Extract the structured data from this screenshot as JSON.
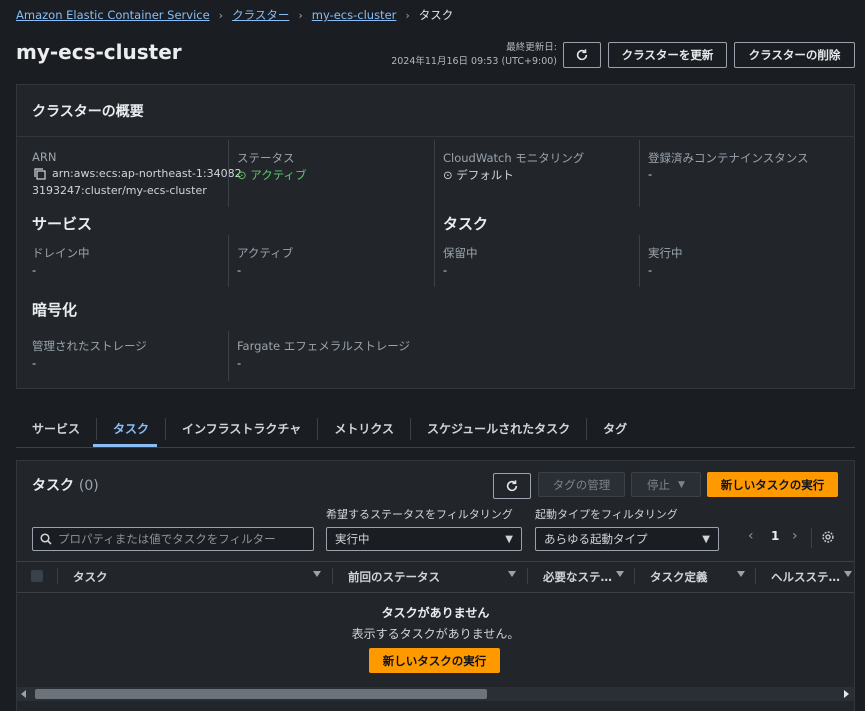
{
  "breadcrumb": {
    "items": [
      "Amazon Elastic Container Service",
      "クラスター",
      "my-ecs-cluster"
    ],
    "current": "タスク"
  },
  "header": {
    "title": "my-ecs-cluster",
    "updated_label": "最終更新日:",
    "updated_value": "2024年11月16日 09:53 (UTC+9:00)",
    "refresh_icon": "refresh-icon",
    "update_button": "クラスターを更新",
    "delete_button": "クラスターの削除"
  },
  "overview": {
    "title": "クラスターの概要",
    "arn_label": "ARN",
    "arn_line1": "arn:aws:ecs:ap-northeast-1:34082",
    "arn_line2": "3193247:cluster/my-ecs-cluster",
    "status_label": "ステータス",
    "status_value": "アクティブ",
    "cloudwatch_label": "CloudWatch モニタリング",
    "cloudwatch_value": "デフォルト",
    "instances_label": "登録済みコンテナインスタンス",
    "instances_value": "-",
    "services_title": "サービス",
    "draining_label": "ドレイン中",
    "draining_value": "-",
    "active_label": "アクティブ",
    "active_value": "-",
    "tasks_title": "タスク",
    "pending_label": "保留中",
    "pending_value": "-",
    "running_label": "実行中",
    "running_value": "-",
    "encryption_title": "暗号化",
    "managed_storage_label": "管理されたストレージ",
    "managed_storage_value": "-",
    "fargate_storage_label": "Fargate エフェメラルストレージ",
    "fargate_storage_value": "-"
  },
  "tabs": [
    "サービス",
    "タスク",
    "インフラストラクチャ",
    "メトリクス",
    "スケジュールされたタスク",
    "タグ"
  ],
  "tasks": {
    "title": "タスク",
    "count": "(0)",
    "manage_tags_button": "タグの管理",
    "stop_button": "停止",
    "run_button": "新しいタスクの実行",
    "search_placeholder": "プロパティまたは値でタスクをフィルター",
    "status_filter_label": "希望するステータスをフィルタリング",
    "status_filter_value": "実行中",
    "launch_filter_label": "起動タイプをフィルタリング",
    "launch_filter_value": "あらゆる起動タイプ",
    "page": "1",
    "columns": [
      "タスク",
      "前回のステータス",
      "必要なステ…",
      "タスク定義",
      "ヘルスステ…"
    ],
    "empty_title": "タスクがありません",
    "empty_desc": "表示するタスクがありません。",
    "empty_button": "新しいタスクの実行"
  }
}
